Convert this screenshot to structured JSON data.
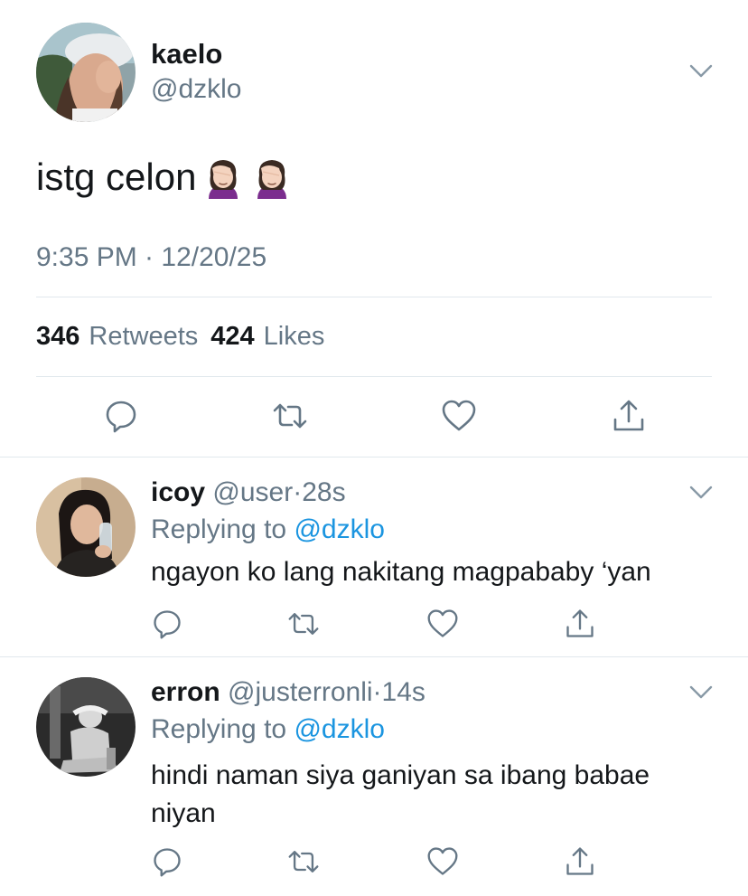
{
  "main_tweet": {
    "display_name": "kaelo",
    "handle": "@dzklo",
    "text": "istg celon",
    "emojis": [
      "woman-facepalming-icon",
      "woman-facepalming-icon"
    ],
    "timestamp": "9:35 PM · 12/20/25",
    "retweets_count": "346",
    "retweets_label": "Retweets",
    "likes_count": "424",
    "likes_label": "Likes"
  },
  "replies": [
    {
      "display_name": "icoy",
      "handle": "@user",
      "separator": "·",
      "time": "28s",
      "replying_prefix": "Replying to",
      "replying_to": "@dzklo",
      "text": "ngayon ko lang nakitang magpababy ‘yan"
    },
    {
      "display_name": "erron",
      "handle": "@justerronli",
      "separator": "·",
      "time": "14s",
      "replying_prefix": "Replying to",
      "replying_to": "@dzklo",
      "text": "hindi naman siya ganiyan sa ibang babae niyan"
    }
  ],
  "icons": [
    "chevron-down-icon",
    "reply-icon",
    "retweet-icon",
    "like-icon",
    "share-icon"
  ],
  "colors": {
    "text": "#14171a",
    "secondary": "#657786",
    "link": "#1b95e0",
    "divider": "#e1e8ed",
    "icon": "#657786"
  }
}
